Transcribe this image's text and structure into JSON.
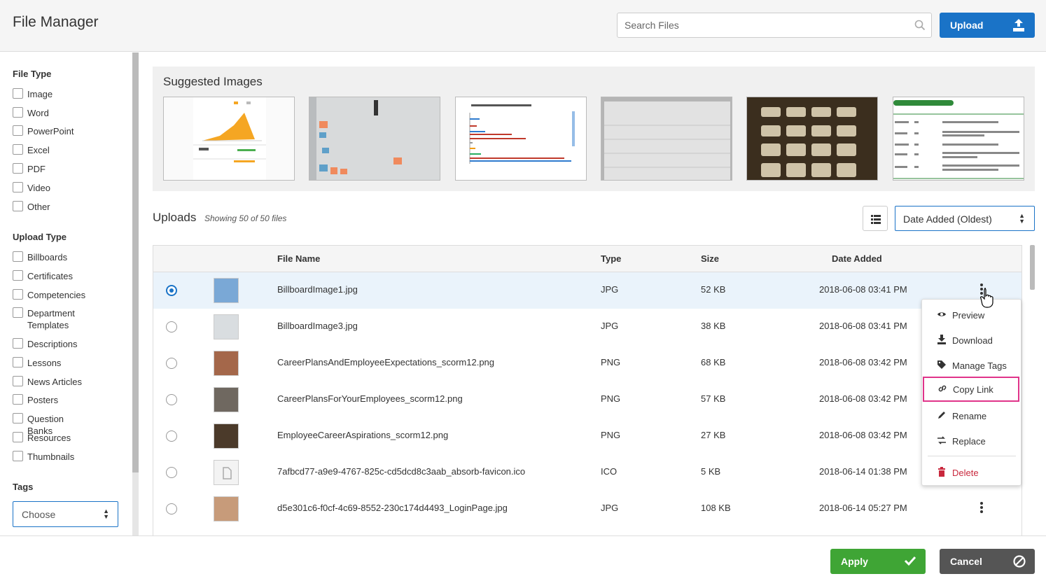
{
  "header": {
    "title": "File Manager",
    "search_placeholder": "Search Files",
    "upload_label": "Upload"
  },
  "sidebar": {
    "file_type_title": "File Type",
    "file_types": [
      "Image",
      "Word",
      "PowerPoint",
      "Excel",
      "PDF",
      "Video",
      "Other"
    ],
    "upload_type_title": "Upload Type",
    "upload_types": [
      "Billboards",
      "Certificates",
      "Competencies",
      "Department Templates",
      "Descriptions",
      "Lessons",
      "News Articles",
      "Posters",
      "Question Banks",
      "Resources",
      "Thumbnails"
    ],
    "tags_title": "Tags",
    "tags_value": "Choose"
  },
  "suggested": {
    "title": "Suggested Images",
    "images": [
      "chart-dashboard",
      "whiteboard-sticky-notes",
      "bar-chart-causas",
      "lined-paper",
      "calculator-keys",
      "result-analysis-table"
    ]
  },
  "uploads": {
    "title": "Uploads",
    "count": "Showing 50 of 50 files",
    "sort_value": "Date Added (Oldest)",
    "columns": {
      "name": "File Name",
      "type": "Type",
      "size": "Size",
      "date": "Date Added"
    },
    "rows": [
      {
        "name": "BillboardImage1.jpg",
        "type": "JPG",
        "size": "52 KB",
        "date": "2018-06-08 03:41 PM",
        "selected": true
      },
      {
        "name": "BillboardImage3.jpg",
        "type": "JPG",
        "size": "38 KB",
        "date": "2018-06-08 03:41 PM"
      },
      {
        "name": "CareerPlansAndEmployeeExpectations_scorm12.png",
        "type": "PNG",
        "size": "68 KB",
        "date": "2018-06-08 03:42 PM"
      },
      {
        "name": "CareerPlansForYourEmployees_scorm12.png",
        "type": "PNG",
        "size": "57 KB",
        "date": "2018-06-08 03:42 PM"
      },
      {
        "name": "EmployeeCareerAspirations_scorm12.png",
        "type": "PNG",
        "size": "27 KB",
        "date": "2018-06-08 03:42 PM"
      },
      {
        "name": "7afbcd77-a9e9-4767-825c-cd5dcd8c3aab_absorb-favicon.ico",
        "type": "ICO",
        "size": "5 KB",
        "date": "2018-06-14 01:38 PM"
      },
      {
        "name": "d5e301c6-f0cf-4c69-8552-230c174d4493_LoginPage.jpg",
        "type": "JPG",
        "size": "108 KB",
        "date": "2018-06-14 05:27 PM"
      }
    ]
  },
  "context_menu": {
    "items": [
      "Preview",
      "Download",
      "Manage Tags",
      "Copy Link",
      "Rename",
      "Replace",
      "Delete"
    ]
  },
  "footer": {
    "apply_label": "Apply",
    "cancel_label": "Cancel"
  },
  "colors": {
    "primary": "#1a73c7",
    "apply": "#3fa535",
    "cancel": "#555555",
    "delete": "#c9283d",
    "highlight": "#e0348a"
  }
}
